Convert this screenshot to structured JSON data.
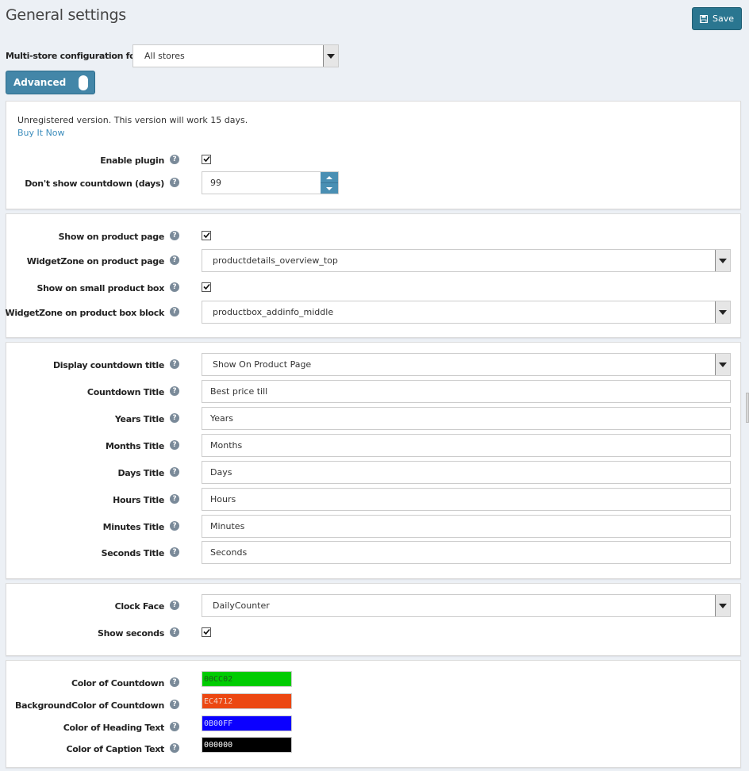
{
  "header": {
    "title": "General settings",
    "save_label": "Save"
  },
  "store": {
    "label": "Multi-store configuration for",
    "value": "All stores"
  },
  "advanced_toggle": {
    "label": "Advanced"
  },
  "license": {
    "notice": "Unregistered version. This version will work 15 days.",
    "buy_link": "Buy It Now"
  },
  "general": {
    "enable_plugin": {
      "label": "Enable plugin",
      "checked": true
    },
    "dont_show_days": {
      "label": "Don't show countdown (days)",
      "value": "99"
    }
  },
  "placement": {
    "show_on_product_page": {
      "label": "Show on product page",
      "checked": true
    },
    "widget_zone_product": {
      "label": "WidgetZone on product page",
      "value": "productdetails_overview_top"
    },
    "show_on_small_box": {
      "label": "Show on small product box",
      "checked": true
    },
    "widget_zone_box": {
      "label": "WidgetZone on product box block",
      "value": "productbox_addinfo_middle"
    }
  },
  "titles": {
    "display_title": {
      "label": "Display countdown title",
      "value": "Show On Product Page"
    },
    "countdown_title": {
      "label": "Countdown Title",
      "value": "Best price till"
    },
    "years_title": {
      "label": "Years Title",
      "value": "Years"
    },
    "months_title": {
      "label": "Months Title",
      "value": "Months"
    },
    "days_title": {
      "label": "Days Title",
      "value": "Days"
    },
    "hours_title": {
      "label": "Hours Title",
      "value": "Hours"
    },
    "minutes_title": {
      "label": "Minutes Title",
      "value": "Minutes"
    },
    "seconds_title": {
      "label": "Seconds Title",
      "value": "Seconds"
    }
  },
  "clock": {
    "clock_face": {
      "label": "Clock Face",
      "value": "DailyCounter"
    },
    "show_seconds": {
      "label": "Show seconds",
      "checked": true
    }
  },
  "colors": {
    "countdown": {
      "label": "Color of Countdown",
      "value": "00CC02",
      "hex": "#00CC02",
      "text_hex": "#1a5c1a"
    },
    "background": {
      "label": "BackgroundColor of Countdown",
      "value": "EC4712",
      "hex": "#EC4712",
      "text_hex": "#f3d2c4"
    },
    "heading": {
      "label": "Color of Heading Text",
      "value": "0B00FF",
      "hex": "#0B00FF",
      "text_hex": "#d0d4ff"
    },
    "caption": {
      "label": "Color of Caption Text",
      "value": "000000",
      "hex": "#000000",
      "text_hex": "#ffffff"
    }
  },
  "icons": {
    "help": "question-circle-icon",
    "save": "floppy-disk-icon",
    "checkbox": "checkmark-icon"
  }
}
